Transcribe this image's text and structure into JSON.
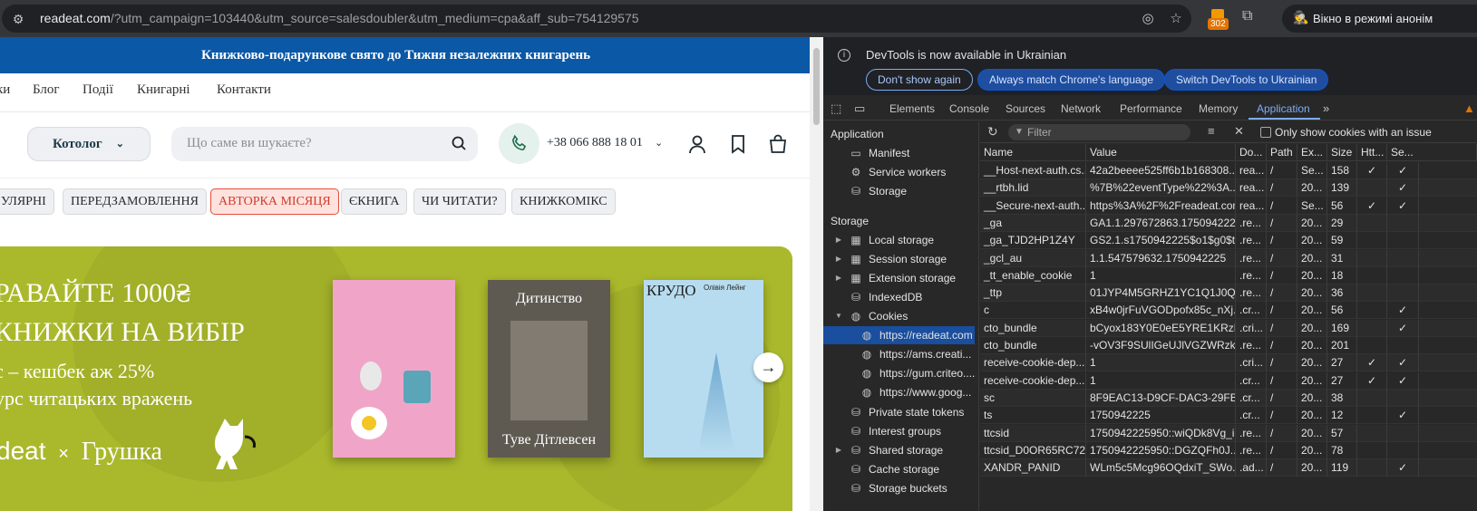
{
  "browser": {
    "url_host": "readeat.com",
    "url_rest": "/?utm_campaign=103440&utm_source=salesdoubler&utm_medium=cpa&aff_sub=754129575",
    "extension_badge": "302",
    "incognito_label": "Вікно в режимі анонім"
  },
  "site": {
    "banner": "Книжково-подарункове свято до Тижня незалежних книгарень",
    "menu": [
      "ки",
      "Блог",
      "Події",
      "Книгарні",
      "Контакти"
    ],
    "catalog_label": "Котолог",
    "search_placeholder": "Що саме ви шукаєте?",
    "phone": "+38 066 888 18 01",
    "tags": [
      "УЛЯРНІ",
      "ПЕРЕДЗАМОВЛЕННЯ",
      "АВТОРКА МІСЯЦЯ",
      "ЄКНИГА",
      "ЧИ ЧИТАТИ?",
      "КНИЖКОМІКС"
    ],
    "promo": {
      "line1": "РАВАЙТЕ 1000₴",
      "line2": "КНИЖКИ НА ВИБІР",
      "line3": "с – кешбек аж 25%",
      "line4": "урс читацьких вражень",
      "logo": "deat",
      "cross": "×",
      "partner": "Грушка",
      "book2_title": "Дитинство",
      "book2_author": "Туве Дітлевсен",
      "book3_title": "КРУДО",
      "book3_author": "Олівія Лейнг"
    }
  },
  "devtools": {
    "notice": "DevTools is now available in Ukrainian",
    "btn_dont_show": "Don't show again",
    "btn_match": "Always match Chrome's language",
    "btn_switch": "Switch DevTools to Ukrainian",
    "tabs": [
      "Elements",
      "Console",
      "Sources",
      "Network",
      "Performance",
      "Memory",
      "Application"
    ],
    "selected_tab": "Application",
    "filter_placeholder": "Filter",
    "only_issues_label": "Only show cookies with an issue",
    "sidebar": {
      "application_header": "Application",
      "app_items": [
        "Manifest",
        "Service workers",
        "Storage"
      ],
      "storage_header": "Storage",
      "storage_items": [
        "Local storage",
        "Session storage",
        "Extension storage",
        "IndexedDB",
        "Cookies"
      ],
      "cookie_origins": [
        "https://readeat.com",
        "https://ams.creati...",
        "https://gum.criteo....",
        "https://www.goog..."
      ],
      "more_items": [
        "Private state tokens",
        "Interest groups",
        "Shared storage",
        "Cache storage",
        "Storage buckets"
      ]
    },
    "table": {
      "columns": [
        "Name",
        "Value",
        "Do...",
        "Path",
        "Ex...",
        "Size",
        "Htt...",
        "Se..."
      ],
      "rows": [
        [
          "__Host-next-auth.cs...",
          "42a2beeee525ff6b1b168308...",
          "rea...",
          "/",
          "Se...",
          "158",
          "✓",
          "✓"
        ],
        [
          "__rtbh.lid",
          "%7B%22eventType%22%3A...",
          "rea...",
          "/",
          "20...",
          "139",
          "",
          "✓"
        ],
        [
          "__Secure-next-auth....",
          "https%3A%2F%2Freadeat.com",
          "rea...",
          "/",
          "Se...",
          "56",
          "✓",
          "✓"
        ],
        [
          "_ga",
          "GA1.1.297672863.1750942226",
          ".re...",
          "/",
          "20...",
          "29",
          "",
          ""
        ],
        [
          "_ga_TJD2HP1Z4Y",
          "GS2.1.s1750942225$o1$g0$t...",
          ".re...",
          "/",
          "20...",
          "59",
          "",
          ""
        ],
        [
          "_gcl_au",
          "1.1.547579632.1750942225",
          ".re...",
          "/",
          "20...",
          "31",
          "",
          ""
        ],
        [
          "_tt_enable_cookie",
          "1",
          ".re...",
          "/",
          "20...",
          "18",
          "",
          ""
        ],
        [
          "_ttp",
          "01JYP4M5GRHZ1YC1Q1J0Q2...",
          ".re...",
          "/",
          "20...",
          "36",
          "",
          ""
        ],
        [
          "c",
          "xB4w0jrFuVGODpofx85c_nXj...",
          ".cr...",
          "/",
          "20...",
          "56",
          "",
          "✓"
        ],
        [
          "cto_bundle",
          "bCyox183Y0E0eE5YRE1KRzB...",
          ".cri...",
          "/",
          "20...",
          "169",
          "",
          "✓"
        ],
        [
          "cto_bundle",
          "-vOV3F9SUlIGeUJlVGZWRzkz...",
          ".re...",
          "/",
          "20...",
          "201",
          "",
          ""
        ],
        [
          "receive-cookie-dep...",
          "1",
          ".cri...",
          "/",
          "20...",
          "27",
          "✓",
          "✓"
        ],
        [
          "receive-cookie-dep...",
          "1",
          ".cr...",
          "/",
          "20...",
          "27",
          "✓",
          "✓"
        ],
        [
          "sc",
          "8F9EAC13-D9CF-DAC3-29FB...",
          ".cr...",
          "/",
          "20...",
          "38",
          "",
          ""
        ],
        [
          "ts",
          "1750942225",
          ".cr...",
          "/",
          "20...",
          "12",
          "",
          "✓"
        ],
        [
          "ttcsid",
          "1750942225950::wiQDk8Vg_i...",
          ".re...",
          "/",
          "20...",
          "57",
          "",
          ""
        ],
        [
          "ttcsid_D0OR65RC72...",
          "1750942225950::DGZQFh0J...",
          ".re...",
          "/",
          "20...",
          "78",
          "",
          ""
        ],
        [
          "XANDR_PANID",
          "WLm5c5Mcg96OQdxiT_SWo...",
          ".ad...",
          "/",
          "20...",
          "119",
          "",
          "✓"
        ]
      ]
    }
  }
}
